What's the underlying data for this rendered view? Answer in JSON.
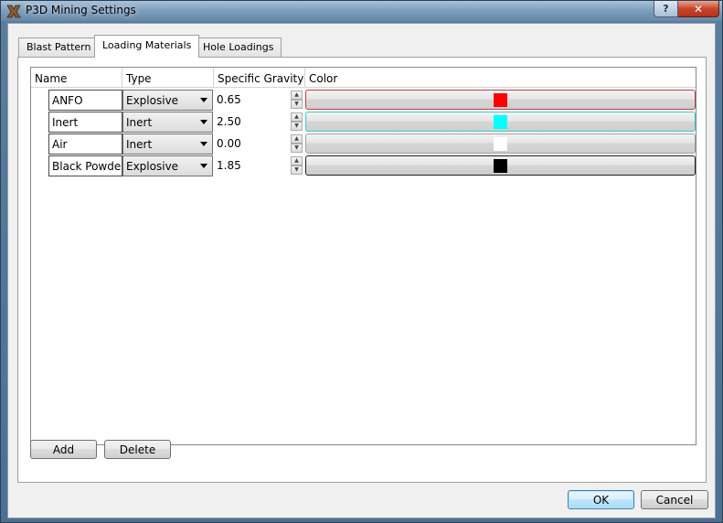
{
  "window": {
    "title": "P3D Mining Settings",
    "help_label": "?",
    "close_label": "✕"
  },
  "tabs": [
    {
      "label": "Blast Pattern",
      "active": false
    },
    {
      "label": "Loading Materials",
      "active": true
    },
    {
      "label": "Hole Loadings",
      "active": false
    }
  ],
  "table": {
    "columns": [
      "Name",
      "Type",
      "Specific Gravity",
      "Color"
    ],
    "rows": [
      {
        "name": "ANFO",
        "type": "Explosive",
        "specific_gravity": "0.65",
        "color": "#ff0000",
        "border_color": "#c04040"
      },
      {
        "name": "Inert",
        "type": "Inert",
        "specific_gravity": "2.50",
        "color": "#00ffff",
        "border_color": "#3cc8c8"
      },
      {
        "name": "Air",
        "type": "Inert",
        "specific_gravity": "0.00",
        "color": "#ffffff",
        "border_color": "#a0a0a0"
      },
      {
        "name": "Black Powder",
        "type": "Explosive",
        "specific_gravity": "1.85",
        "color": "#000000",
        "border_color": "#202020"
      }
    ]
  },
  "buttons": {
    "add": "Add",
    "delete": "Delete",
    "ok": "OK",
    "cancel": "Cancel"
  }
}
